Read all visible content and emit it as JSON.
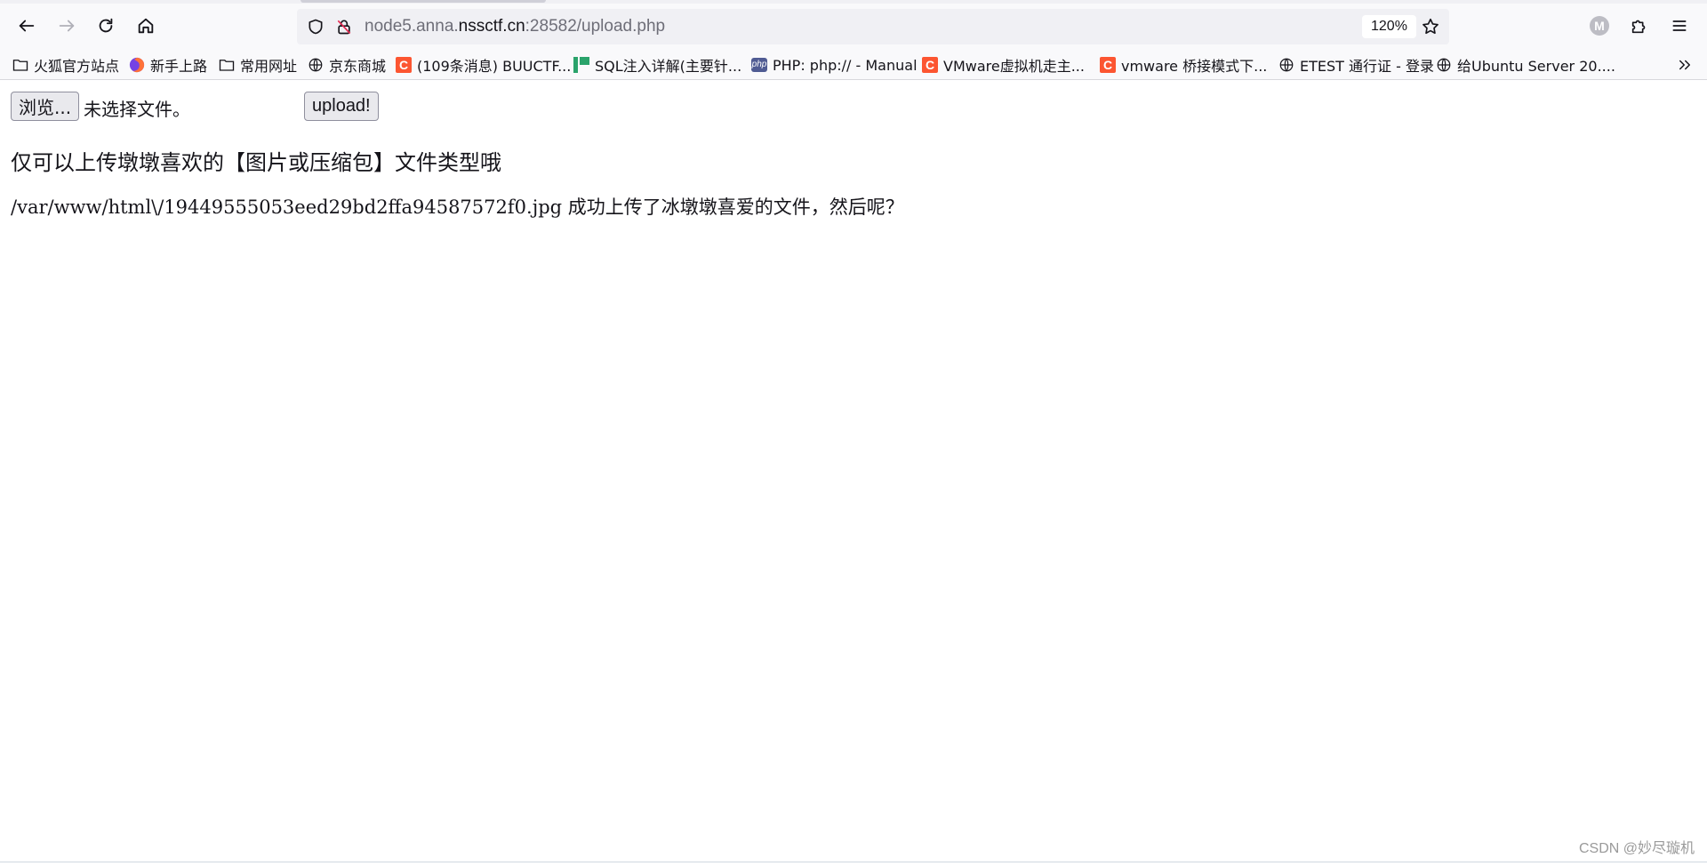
{
  "browser": {
    "url_prefix": "node5.anna.",
    "url_domain": "nssctf.cn",
    "url_suffix": ":28582/upload.php",
    "zoom": "120%",
    "profile_initial": "M"
  },
  "bookmarks": [
    {
      "label": "火狐官方站点",
      "icon": "folder-icon"
    },
    {
      "label": "新手上路",
      "icon": "firefox-icon"
    },
    {
      "label": "常用网址",
      "icon": "folder-icon"
    },
    {
      "label": "京东商城",
      "icon": "globe-icon"
    },
    {
      "label": "(109条消息) BUUCTF...",
      "icon": "csdn-icon"
    },
    {
      "label": "SQL注入详解(主要针...",
      "icon": "sql-site-icon"
    },
    {
      "label": "PHP: php:// - Manual",
      "icon": "php-icon"
    },
    {
      "label": "VMware虚拟机走主...",
      "icon": "csdn-icon"
    },
    {
      "label": "vmware 桥接模式下...",
      "icon": "csdn-icon"
    },
    {
      "label": "ETEST 通行证 - 登录",
      "icon": "globe-icon"
    },
    {
      "label": "给Ubuntu Server 20....",
      "icon": "globe-icon"
    }
  ],
  "icon_labels": {
    "csdn": "C",
    "php": "php"
  },
  "page": {
    "browse_label": "浏览...",
    "file_status": "未选择文件。",
    "upload_label": "upload!",
    "heading": "仅可以上传墩墩喜欢的【图片或压缩包】文件类型哦",
    "result_text": "/var/www/html\\/19449555053eed29bd2ffa94587572f0.jpg 成功上传了冰墩墩喜爱的文件，然后呢？"
  },
  "watermark": "CSDN @妙尽璇机"
}
